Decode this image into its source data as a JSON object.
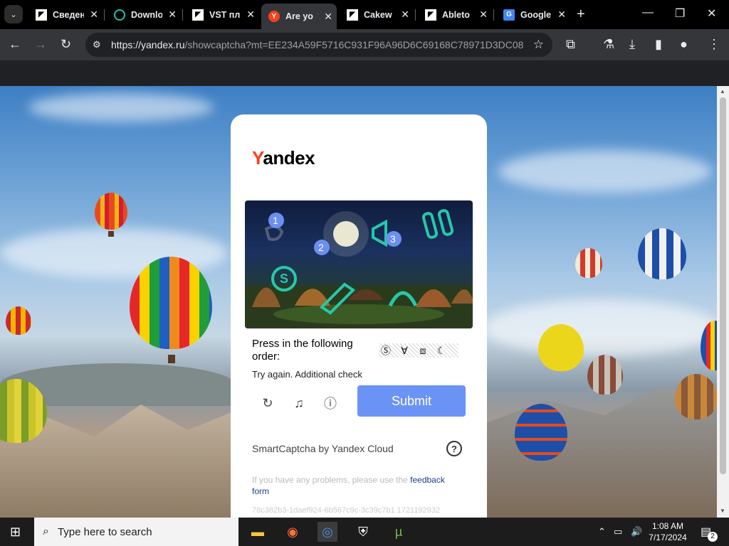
{
  "browser": {
    "tabs": [
      {
        "title": "Сведен",
        "favicon": "generic-doc-icon",
        "active": false
      },
      {
        "title": "Downlo",
        "favicon": "globe-teal-icon",
        "active": false
      },
      {
        "title": "VST пл",
        "favicon": "generic-doc-icon",
        "active": false
      },
      {
        "title": "Are yo",
        "favicon": "yandex-icon",
        "active": true
      },
      {
        "title": "Cakew",
        "favicon": "generic-doc-icon",
        "active": false
      },
      {
        "title": "Ableto",
        "favicon": "generic-doc-icon",
        "active": false
      },
      {
        "title": "Google",
        "favicon": "google-translate-icon",
        "active": false
      }
    ],
    "url_host": "https://yandex.ru",
    "url_rest": "/showcaptcha?mt=EE234A59F5716C931F96A96D6C69168C78971D3DC082..."
  },
  "captcha": {
    "logo_first": "Y",
    "logo_rest": "andex",
    "puzzle_markers": [
      "1",
      "2",
      "3"
    ],
    "prompt": "Press in the following order:",
    "order_icons": [
      "Ⓢ",
      "∀",
      "⧈",
      "☾"
    ],
    "status": "Try again. Additional check",
    "submit_label": "Submit",
    "brand": "SmartCaptcha by Yandex Cloud",
    "help_label": "?",
    "problems_text": "If you have any problems, please use the ",
    "problems_link": "feedback form",
    "request_id": "78c382b3-1daef924-6b567c9c-3c39c7b1 1721192932",
    "accent_color": "#6b93f5"
  },
  "taskbar": {
    "search_placeholder": "Type here to search",
    "apps": [
      "file-explorer-icon",
      "firefox-icon",
      "chrome-icon",
      "security-shield-icon",
      "utorrent-icon"
    ],
    "time": "1:08 AM",
    "date": "7/17/2024",
    "notification_count": "2"
  }
}
